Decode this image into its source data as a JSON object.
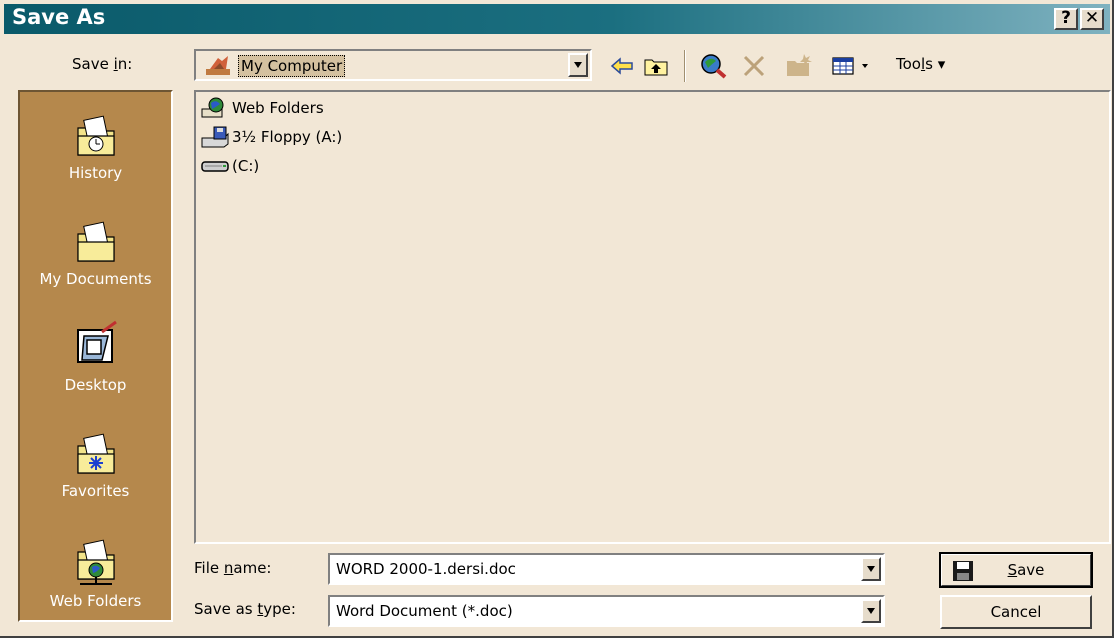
{
  "window": {
    "title": "Save As",
    "help_button": "?",
    "close_button": "✕"
  },
  "save_in": {
    "label_pre": "Save ",
    "label_key": "i",
    "label_post": "n:",
    "value": "My Computer"
  },
  "toolbar": {
    "back_icon": "back-arrow-icon",
    "up_icon": "up-one-level-icon",
    "search_web_icon": "search-web-icon",
    "delete_icon": "delete-icon",
    "new_folder_icon": "new-folder-icon",
    "views_icon": "views-icon",
    "tools_pre": "Too",
    "tools_key": "l",
    "tools_post": "s"
  },
  "places_bar": [
    {
      "label": "History",
      "icon": "history-folder-icon"
    },
    {
      "label": "My Documents",
      "icon": "my-documents-folder-icon"
    },
    {
      "label": "Desktop",
      "icon": "desktop-icon"
    },
    {
      "label": "Favorites",
      "icon": "favorites-folder-icon"
    },
    {
      "label": "Web Folders",
      "icon": "web-folders-icon"
    }
  ],
  "file_list": [
    {
      "label": "Web Folders",
      "icon": "web-folders-icon"
    },
    {
      "label": "3½ Floppy (A:)",
      "icon": "floppy-drive-icon"
    },
    {
      "label": "(C:)",
      "icon": "hard-drive-icon"
    }
  ],
  "file_name": {
    "label_pre": "File ",
    "label_key": "n",
    "label_post": "ame:",
    "value": "WORD 2000-1.dersi.doc"
  },
  "save_as_type": {
    "label_pre": "Save as ",
    "label_key": "t",
    "label_post": "ype:",
    "value": "Word Document (*.doc)"
  },
  "buttons": {
    "save_key": "S",
    "save_rest": "ave",
    "cancel": "Cancel"
  },
  "colors": {
    "titlebar": "#0a5a6a",
    "dialog_bg": "#f2e7d6",
    "places_bg": "#b5884c"
  }
}
